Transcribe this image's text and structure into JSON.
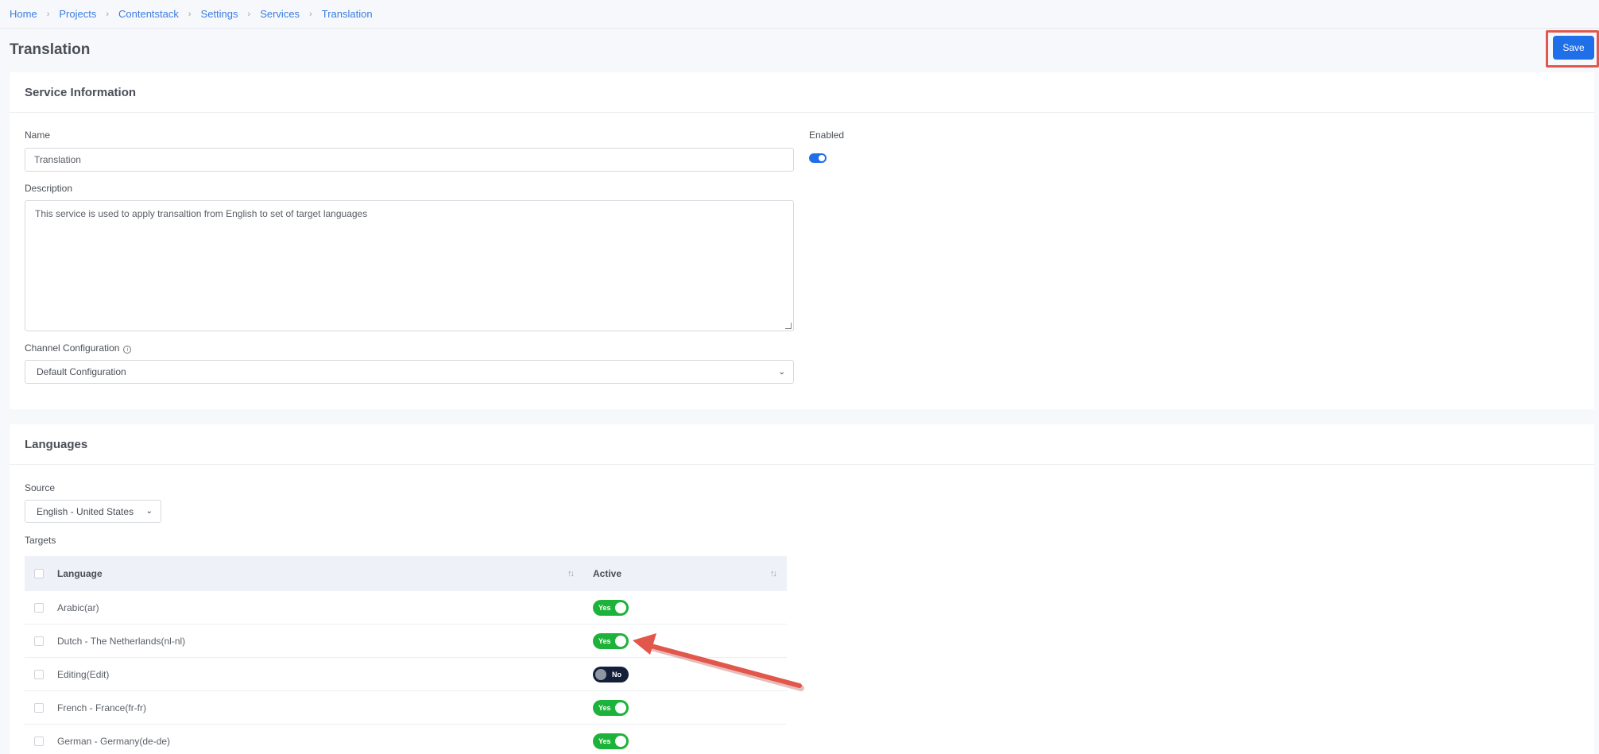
{
  "breadcrumb": [
    "Home",
    "Projects",
    "Contentstack",
    "Settings",
    "Services",
    "Translation"
  ],
  "page": {
    "title": "Translation",
    "save_label": "Save"
  },
  "service_info": {
    "heading": "Service Information",
    "name_label": "Name",
    "name_value": "Translation",
    "enabled_label": "Enabled",
    "enabled": true,
    "description_label": "Description",
    "description_value": "This service  is used to apply transaltion from English to set of target languages",
    "channel_label": "Channel Configuration",
    "channel_value": "Default Configuration"
  },
  "languages": {
    "heading": "Languages",
    "source_label": "Source",
    "source_value": "English - United States",
    "targets_label": "Targets",
    "columns": {
      "language": "Language",
      "active": "Active"
    },
    "rows": [
      {
        "language": "Arabic(ar)",
        "active": "Yes"
      },
      {
        "language": "Dutch - The Netherlands(nl-nl)",
        "active": "Yes"
      },
      {
        "language": "Editing(Edit)",
        "active": "No"
      },
      {
        "language": "French - France(fr-fr)",
        "active": "Yes"
      },
      {
        "language": "German - Germany(de-de)",
        "active": "Yes"
      }
    ]
  },
  "colors": {
    "accent": "#1f6fe8",
    "active_yes": "#1db33a",
    "active_no": "#14203a",
    "annotation": "#e2574c"
  }
}
